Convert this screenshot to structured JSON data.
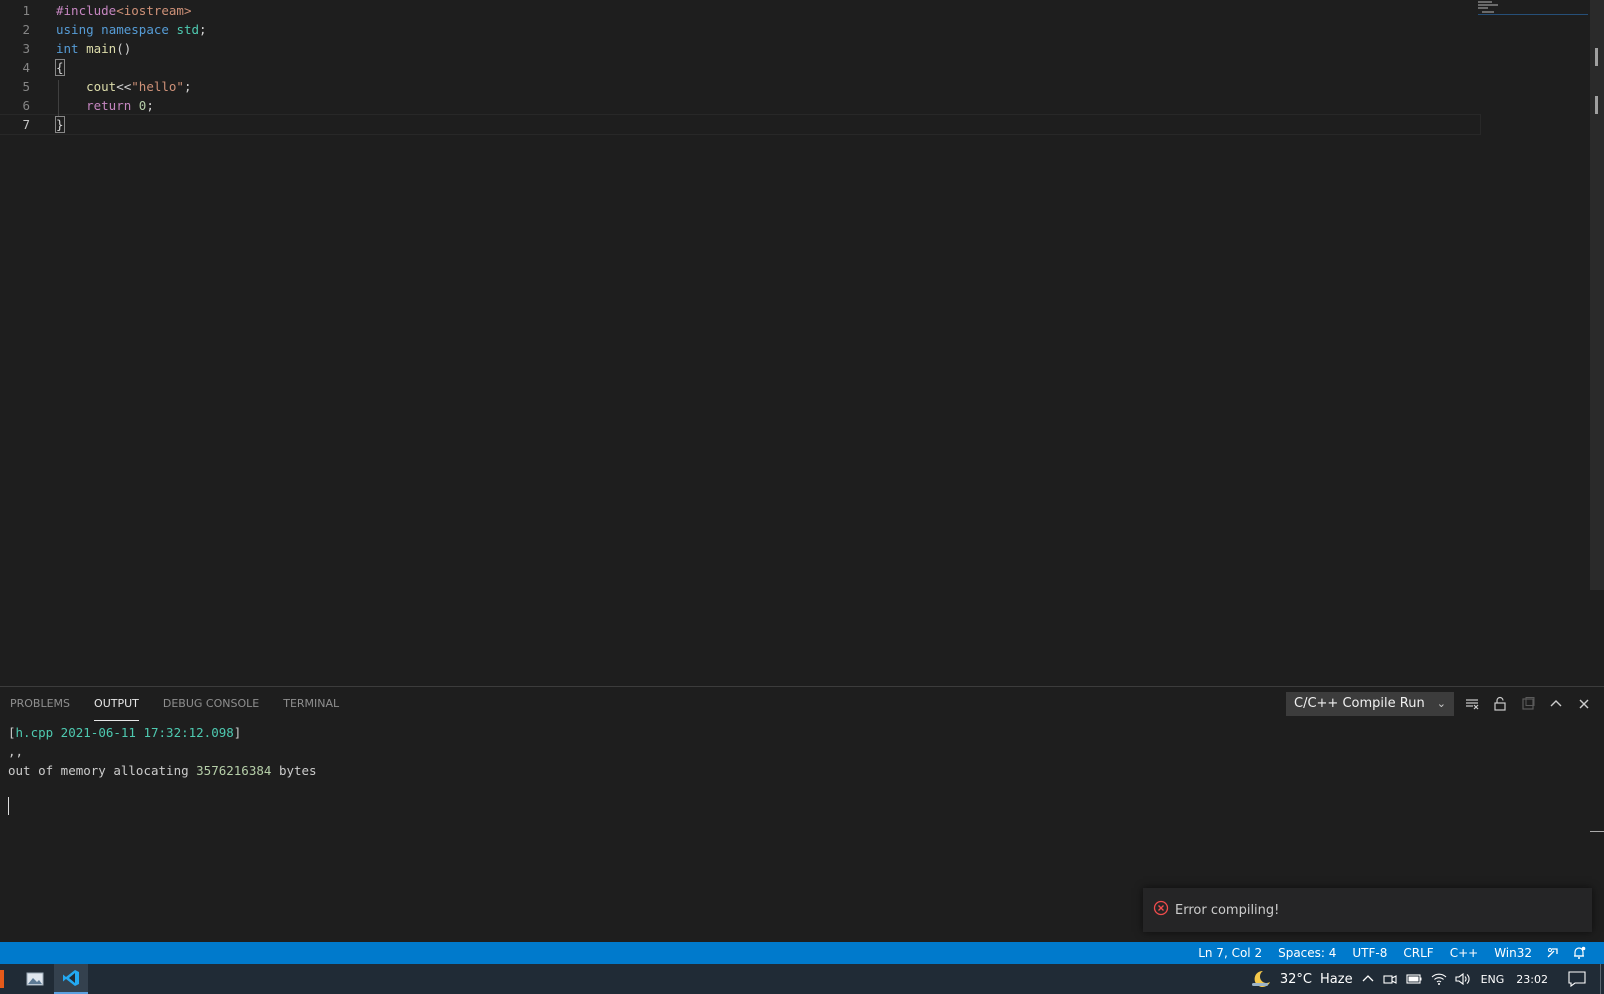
{
  "editor": {
    "lines": [
      {
        "num": "1",
        "tokens": [
          {
            "t": "#include",
            "c": "pp"
          },
          {
            "t": "<iostream>",
            "c": "str"
          }
        ]
      },
      {
        "num": "2",
        "tokens": [
          {
            "t": "using",
            "c": "kw"
          },
          {
            "t": " ",
            "c": "pl"
          },
          {
            "t": "namespace",
            "c": "kw"
          },
          {
            "t": " ",
            "c": "pl"
          },
          {
            "t": "std",
            "c": "ns"
          },
          {
            "t": ";",
            "c": "pl"
          }
        ]
      },
      {
        "num": "3",
        "tokens": [
          {
            "t": "int",
            "c": "kw"
          },
          {
            "t": " ",
            "c": "pl"
          },
          {
            "t": "main",
            "c": "fn"
          },
          {
            "t": "()",
            "c": "pl"
          }
        ]
      },
      {
        "num": "4",
        "tokens": [
          {
            "t": "{",
            "c": "brace"
          }
        ]
      },
      {
        "num": "5",
        "tokens": [
          {
            "t": "    ",
            "c": "pl"
          },
          {
            "t": "cout",
            "c": "fn"
          },
          {
            "t": "<<",
            "c": "pl"
          },
          {
            "t": "\"hello\"",
            "c": "str"
          },
          {
            "t": ";",
            "c": "pl"
          }
        ]
      },
      {
        "num": "6",
        "tokens": [
          {
            "t": "    ",
            "c": "pl"
          },
          {
            "t": "return",
            "c": "ctl"
          },
          {
            "t": " ",
            "c": "pl"
          },
          {
            "t": "0",
            "c": "num"
          },
          {
            "t": ";",
            "c": "pl"
          }
        ]
      },
      {
        "num": "7",
        "tokens": [
          {
            "t": "}",
            "c": "brace"
          }
        ]
      }
    ],
    "current_line": "7"
  },
  "panel": {
    "tabs": [
      {
        "label": "PROBLEMS",
        "name": "tab-problems",
        "active": false
      },
      {
        "label": "OUTPUT",
        "name": "tab-output",
        "active": true
      },
      {
        "label": "DEBUG CONSOLE",
        "name": "tab-debug-console",
        "active": false
      },
      {
        "label": "TERMINAL",
        "name": "tab-terminal",
        "active": false
      }
    ],
    "output_channel": "C/C++ Compile Run",
    "output": {
      "line1_open": "[",
      "line1_file": "h.cpp 2021-06-11 17:32:12.098",
      "line1_close": "]",
      "line2": ",,",
      "line3_prefix": "out of memory allocating ",
      "line3_number": "3576216384",
      "line3_suffix": " bytes"
    }
  },
  "notification": {
    "message": "Error compiling!",
    "icon": "error-circle-icon",
    "color": "#f14c4c"
  },
  "statusbar": {
    "position": "Ln 7, Col 2",
    "spaces": "Spaces: 4",
    "encoding": "UTF-8",
    "eol": "CRLF",
    "language": "C++",
    "platform": "Win32",
    "color": "#007acc"
  },
  "taskbar": {
    "temperature": "32°C",
    "weather": "Haze",
    "language": "ENG",
    "time": "23:02"
  }
}
